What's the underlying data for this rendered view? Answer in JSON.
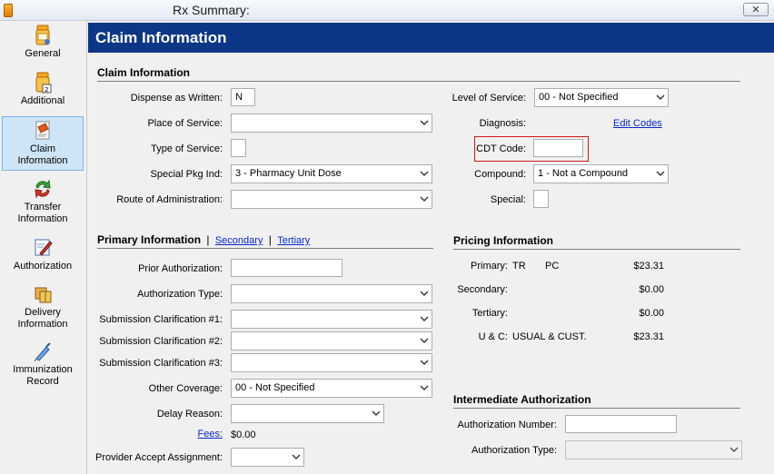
{
  "window": {
    "title": "Rx Summary:",
    "close_glyph": "✕"
  },
  "sidebar": {
    "items": [
      {
        "label_line1": "General",
        "label_line2": ""
      },
      {
        "label_line1": "Additional",
        "label_line2": ""
      },
      {
        "label_line1": "Claim",
        "label_line2": "Information"
      },
      {
        "label_line1": "Transfer",
        "label_line2": "Information"
      },
      {
        "label_line1": "Authorization",
        "label_line2": ""
      },
      {
        "label_line1": "Delivery",
        "label_line2": "Information"
      },
      {
        "label_line1": "Immunization",
        "label_line2": "Record"
      }
    ],
    "selected_index": 2
  },
  "banner": {
    "title": "Claim Information"
  },
  "claim_info": {
    "section_title": "Claim Information",
    "dispense_as_written": {
      "label": "Dispense as Written:",
      "value": "N"
    },
    "place_of_service": {
      "label": "Place of Service:",
      "value": ""
    },
    "type_of_service": {
      "label": "Type of Service:",
      "value": ""
    },
    "special_pkg_ind": {
      "label": "Special Pkg Ind:",
      "value": "3 - Pharmacy Unit Dose"
    },
    "route_of_admin": {
      "label": "Route of Administration:",
      "value": ""
    },
    "level_of_service": {
      "label": "Level of Service:",
      "value": "00 - Not Specified"
    },
    "diagnosis": {
      "label": "Diagnosis:",
      "link": "Edit Codes"
    },
    "cdt_code": {
      "label": "CDT Code:",
      "value": ""
    },
    "compound": {
      "label": "Compound:",
      "value": "1 - Not a Compound"
    },
    "special": {
      "label": "Special:",
      "value": ""
    }
  },
  "primary_info": {
    "section_title": "Primary Information",
    "separator": "|",
    "secondary_link": "Secondary",
    "tertiary_link": "Tertiary",
    "prior_authorization": {
      "label": "Prior Authorization:",
      "value": ""
    },
    "authorization_type": {
      "label": "Authorization Type:",
      "value": ""
    },
    "submission_clar_1": {
      "label": "Submission Clarification #1:",
      "value": ""
    },
    "submission_clar_2": {
      "label": "Submission Clarification #2:",
      "value": ""
    },
    "submission_clar_3": {
      "label": "Submission Clarification #3:",
      "value": ""
    },
    "other_coverage": {
      "label": "Other Coverage:",
      "value": "00 - Not Specified"
    },
    "delay_reason": {
      "label": "Delay Reason:",
      "value": ""
    },
    "fees": {
      "label": "Fees:",
      "value": "$0.00"
    },
    "provider_accept_assignment": {
      "label": "Provider Accept Assignment:",
      "value": ""
    }
  },
  "pricing_info": {
    "section_title": "Pricing Information",
    "rows": [
      {
        "label": "Primary:",
        "code1": "TR",
        "code2": "PC",
        "amount": "$23.31"
      },
      {
        "label": "Secondary:",
        "code1": "",
        "code2": "",
        "amount": "$0.00"
      },
      {
        "label": "Tertiary:",
        "code1": "",
        "code2": "",
        "amount": "$0.00"
      },
      {
        "label": "U & C:",
        "code1": "USUAL & CUST.",
        "code2": "",
        "amount": "$23.31"
      }
    ]
  },
  "intermediate_auth": {
    "section_title": "Intermediate Authorization",
    "authorization_number": {
      "label": "Authorization Number:",
      "value": ""
    },
    "authorization_type": {
      "label": "Authorization Type:",
      "value": ""
    }
  },
  "colors": {
    "banner": "#0c3686",
    "link": "#0a28c8",
    "highlight": "#d0181b",
    "selected_nav": "#cde5f7"
  }
}
